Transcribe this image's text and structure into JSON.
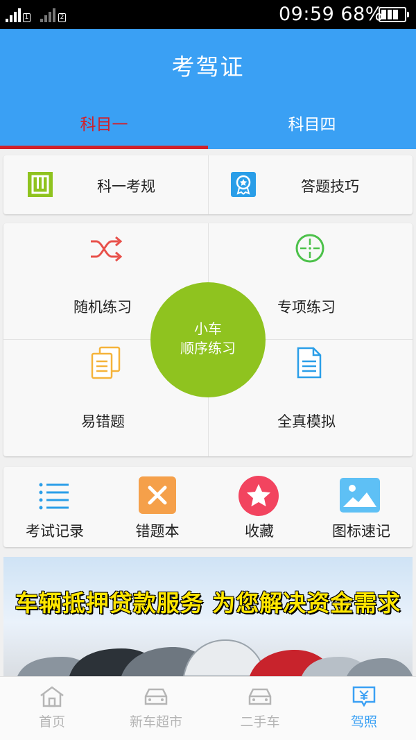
{
  "status_bar": {
    "time": "09:59",
    "battery": "68%",
    "sim1": "1",
    "sim2": "2"
  },
  "header": {
    "title": "考驾证",
    "tabs": [
      {
        "label": "科目一",
        "active": true
      },
      {
        "label": "科目四",
        "active": false
      }
    ]
  },
  "top_links": [
    {
      "label": "科一考规",
      "icon": "book-icon"
    },
    {
      "label": "答题技巧",
      "icon": "badge-icon"
    }
  ],
  "practice": {
    "center_line1": "小车",
    "center_line2": "顺序练习",
    "items": [
      {
        "label": "随机练习",
        "icon": "shuffle-icon"
      },
      {
        "label": "专项练习",
        "icon": "target-icon"
      },
      {
        "label": "易错题",
        "icon": "documents-icon"
      },
      {
        "label": "全真模拟",
        "icon": "document-icon"
      }
    ]
  },
  "quick": [
    {
      "label": "考试记录",
      "icon": "list-icon"
    },
    {
      "label": "错题本",
      "icon": "x-icon"
    },
    {
      "label": "收藏",
      "icon": "star-icon"
    },
    {
      "label": "图标速记",
      "icon": "image-icon"
    }
  ],
  "banner": {
    "text": "车辆抵押贷款服务 为您解决资金需求"
  },
  "bottom_nav": [
    {
      "label": "首页",
      "icon": "home-icon",
      "active": false
    },
    {
      "label": "新车超市",
      "icon": "car-icon",
      "active": false
    },
    {
      "label": "二手车",
      "icon": "car-icon",
      "active": false
    },
    {
      "label": "驾照",
      "icon": "yen-chat-icon",
      "active": true
    }
  ],
  "colors": {
    "primary": "#3aa0f4",
    "tab_active": "#d0202a",
    "center_circle": "#8fc31f",
    "shuffle": "#e8504a",
    "target": "#4cc14a",
    "documents": "#f5b33a",
    "document": "#2a9ee8",
    "x_box": "#f5a04a",
    "star": "#f2445f",
    "image": "#5ec0f5"
  }
}
